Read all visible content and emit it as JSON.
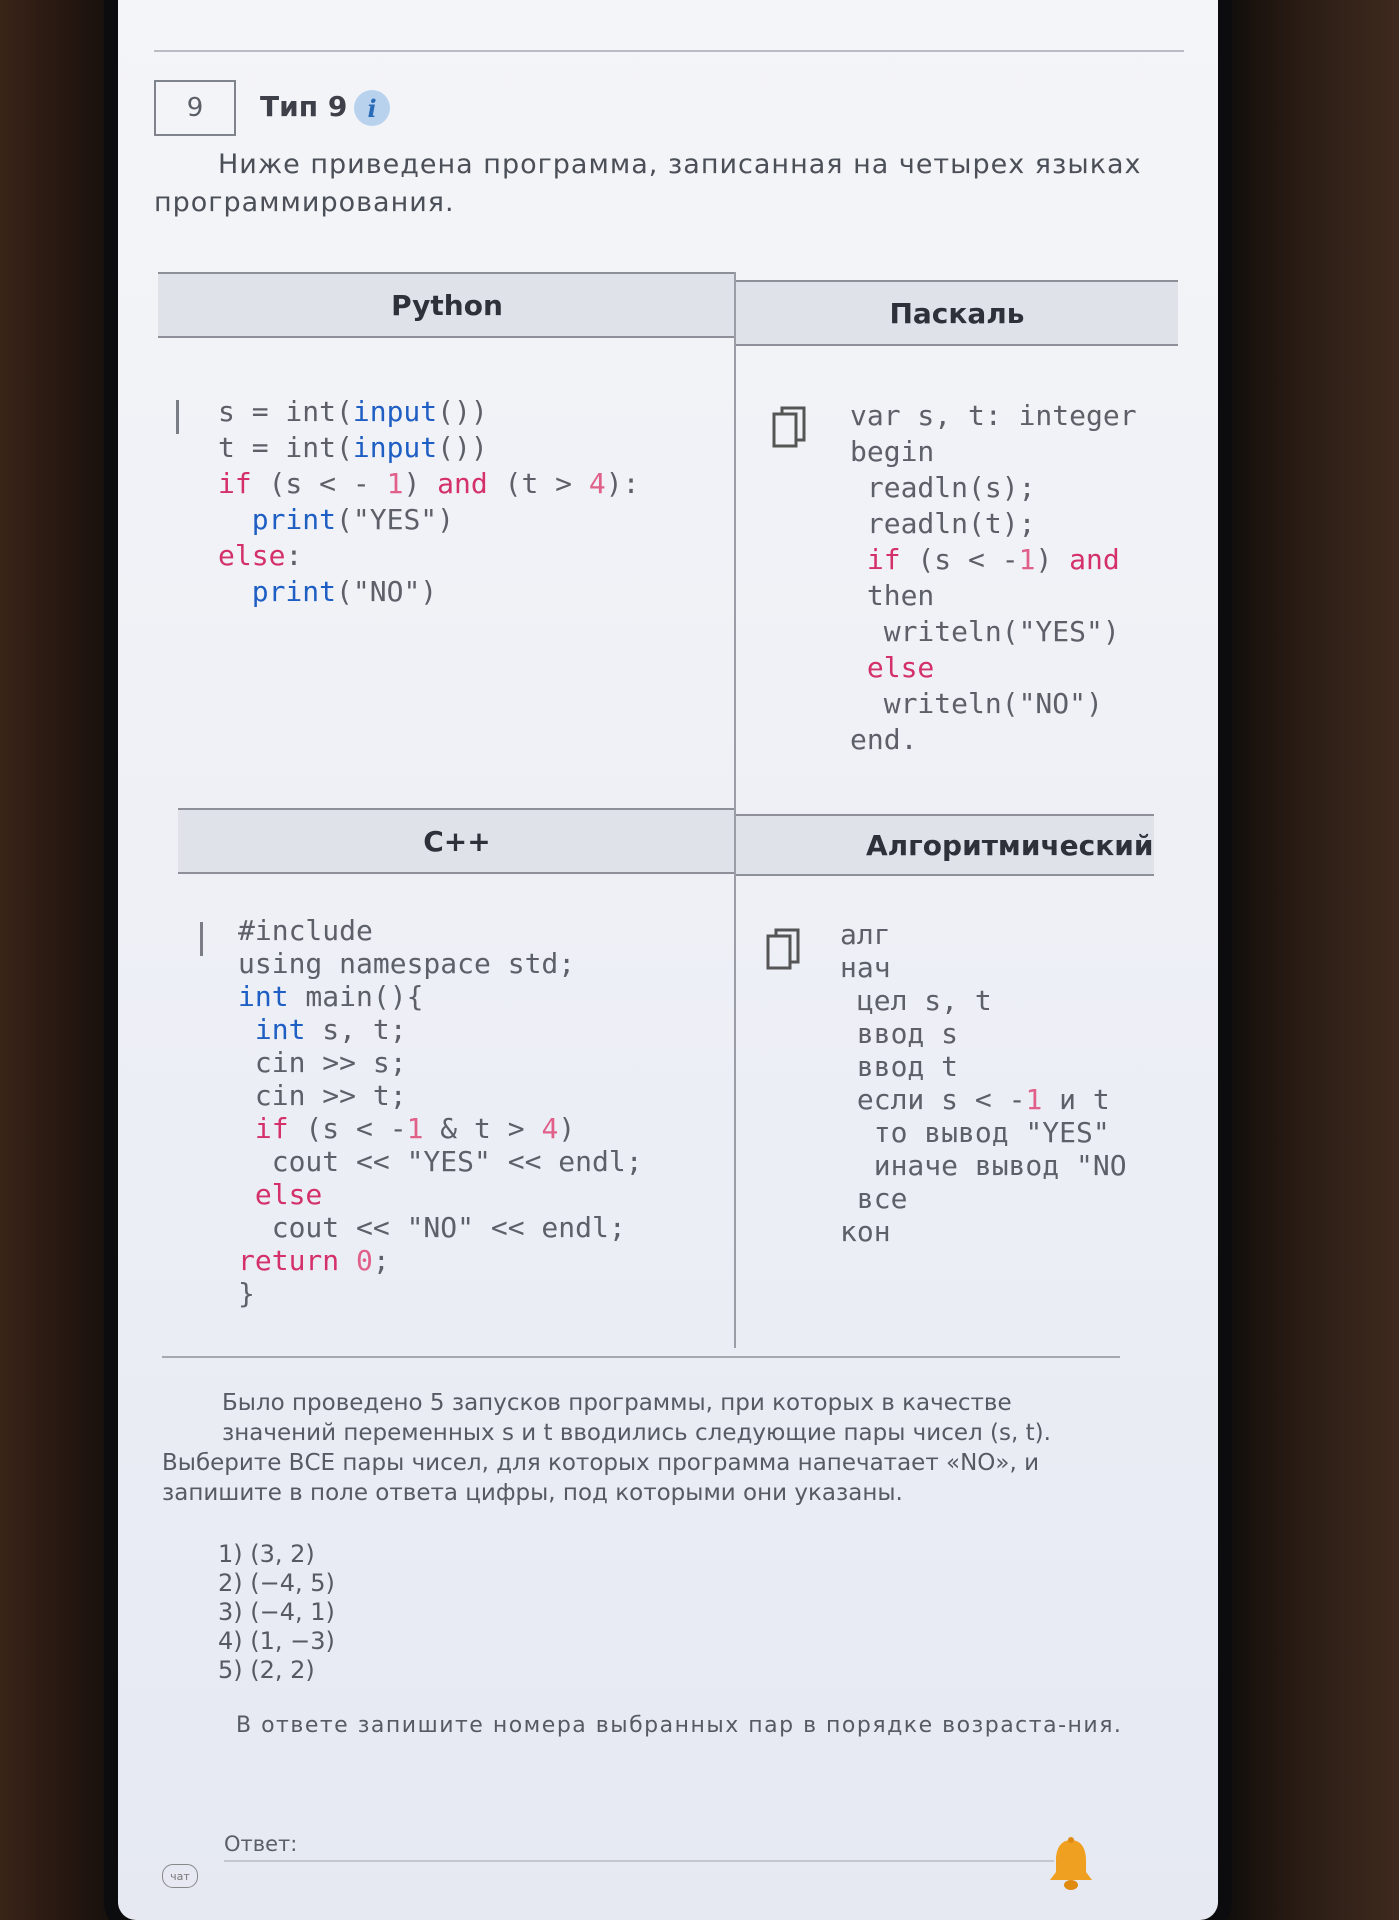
{
  "task": {
    "number": "9",
    "type_label": "Тип 9",
    "info_icon_text": "i",
    "intro": "Ниже приведена программа, записанная на четырех языках программирования."
  },
  "table": {
    "headers": {
      "python": "Python",
      "pascal": "Паскаль",
      "cpp": "C++",
      "algorithmic": "Алгоритмический яз"
    }
  },
  "code": {
    "python": [
      "s = int(input())",
      "t = int(input())",
      "if (s < - 1) and (t > 4):",
      "  print(\"YES\")",
      "else:",
      "  print(\"NO\")"
    ],
    "pascal": [
      "var s, t: integer",
      "begin",
      " readln(s);",
      " readln(t);",
      " if (s < -1) and",
      " then",
      "  writeln(\"YES\")",
      " else",
      "  writeln(\"NO\")",
      "end."
    ],
    "cpp": [
      "#include",
      "using namespace std;",
      "int main(){",
      " int s, t;",
      " cin >> s;",
      " cin >> t;",
      " if (s < -1 & t > 4)",
      "  cout << \"YES\" << endl;",
      " else",
      "  cout << \"NO\" << endl;",
      "return 0;",
      "}"
    ],
    "algorithmic": [
      "алг",
      "нач",
      " цел s, t",
      " ввод s",
      " ввод t",
      " если s < -1 и t",
      "  то вывод \"YES\"",
      "  иначе вывод \"NO",
      " все",
      "кон"
    ]
  },
  "question": {
    "line1": "Было проведено 5 запусков программы, при которых в качестве значений переменных s и t вводились следующие пары чисел (s, t).",
    "line2": "Выберите ВСЕ пары чисел, для которых программа напечатает «NO», и запишите в поле ответа цифры, под которыми они указаны."
  },
  "options": [
    "1) (3, 2)",
    "2) (−4, 5)",
    "3) (−4, 1)",
    "4) (1, −3)",
    "5) (2, 2)"
  ],
  "note": "В ответе запишите номера выбранных пар в порядке возраста-ния.",
  "answer": {
    "label": "Ответ:",
    "value": ""
  },
  "chat_badge": "чат",
  "icons": {
    "copy": "copy-icon",
    "bell": "bell-icon",
    "info": "info-icon"
  },
  "colors": {
    "keyword_red": "#d4306a",
    "keyword_blue": "#1f5fc4",
    "header_bg": "#dfe2e8",
    "info_bg": "#b8d2ee",
    "bell": "#f0a020"
  }
}
